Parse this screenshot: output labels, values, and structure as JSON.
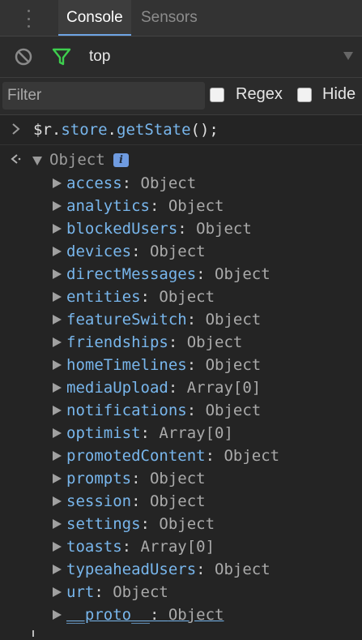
{
  "tabs": [
    {
      "label": "Console",
      "active": true
    },
    {
      "label": "Sensors",
      "active": false
    }
  ],
  "toolbar": {
    "context": "top"
  },
  "filterbar": {
    "placeholder": "Filter",
    "value": "",
    "regex_label": "Regex",
    "hide_label": "Hide"
  },
  "console": {
    "command": {
      "var": "$r",
      "dot1": ".",
      "prop1": "store",
      "dot2": ".",
      "prop2": "getState",
      "tail": "();"
    },
    "result": {
      "label": "Object",
      "info": "i",
      "properties": [
        {
          "name": "access",
          "value": "Object"
        },
        {
          "name": "analytics",
          "value": "Object"
        },
        {
          "name": "blockedUsers",
          "value": "Object"
        },
        {
          "name": "devices",
          "value": "Object"
        },
        {
          "name": "directMessages",
          "value": "Object"
        },
        {
          "name": "entities",
          "value": "Object"
        },
        {
          "name": "featureSwitch",
          "value": "Object"
        },
        {
          "name": "friendships",
          "value": "Object"
        },
        {
          "name": "homeTimelines",
          "value": "Object"
        },
        {
          "name": "mediaUpload",
          "value": "Array[0]"
        },
        {
          "name": "notifications",
          "value": "Object"
        },
        {
          "name": "optimist",
          "value": "Array[0]"
        },
        {
          "name": "promotedContent",
          "value": "Object"
        },
        {
          "name": "prompts",
          "value": "Object"
        },
        {
          "name": "session",
          "value": "Object"
        },
        {
          "name": "settings",
          "value": "Object"
        },
        {
          "name": "toasts",
          "value": "Array[0]"
        },
        {
          "name": "typeaheadUsers",
          "value": "Object"
        },
        {
          "name": "urt",
          "value": "Object"
        },
        {
          "name": "__proto__",
          "value": "Object"
        }
      ]
    }
  },
  "colors": {
    "background": "#242424",
    "property_name": "#78b6ec",
    "filter_icon": "#3ecf4e",
    "info_badge": "#6f9be0"
  },
  "icons": [
    "drag-handle-icon",
    "block-icon",
    "filter-icon",
    "dropdown-arrow-icon",
    "prompt-chevron-icon",
    "result-arrow-icon",
    "expand-triangle-icon",
    "collapse-triangle-icon",
    "info-icon"
  ]
}
